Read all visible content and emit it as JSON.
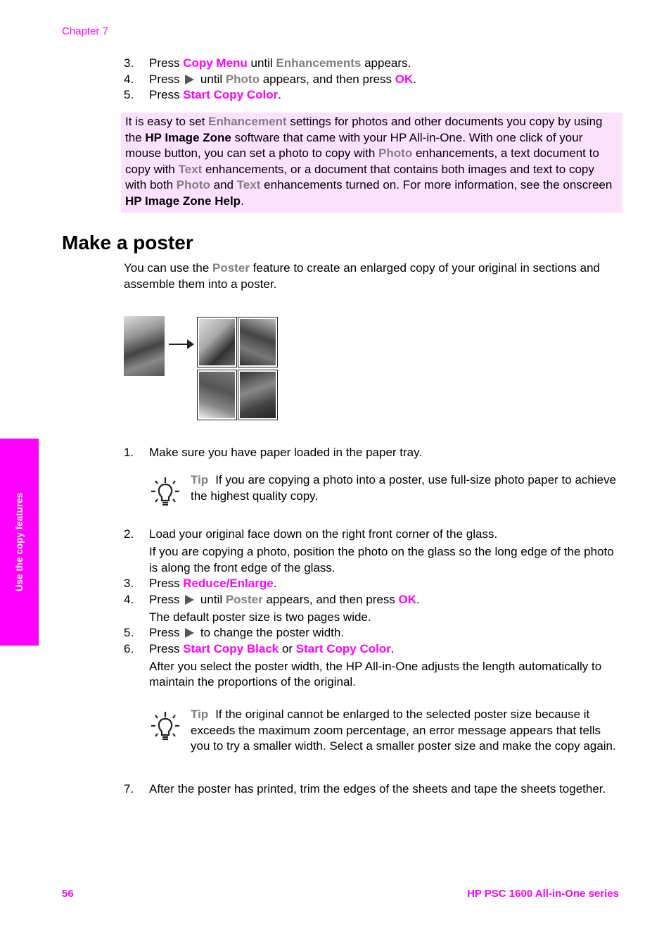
{
  "header": {
    "chapter": "Chapter 7"
  },
  "side_tab": {
    "label": "Use the copy features"
  },
  "top_steps": [
    {
      "num": "3.",
      "parts": [
        {
          "t": "Press ",
          "s": ""
        },
        {
          "t": "Copy Menu",
          "s": "magenta"
        },
        {
          "t": " until ",
          "s": ""
        },
        {
          "t": "Enhancements",
          "s": "gray"
        },
        {
          "t": " appears.",
          "s": ""
        }
      ]
    },
    {
      "num": "4.",
      "parts": [
        {
          "t": "Press ",
          "s": ""
        },
        {
          "t": "",
          "s": "arrow"
        },
        {
          "t": " until ",
          "s": ""
        },
        {
          "t": "Photo",
          "s": "gray"
        },
        {
          "t": " appears, and then press ",
          "s": ""
        },
        {
          "t": "OK",
          "s": "magenta"
        },
        {
          "t": ".",
          "s": ""
        }
      ]
    },
    {
      "num": "5.",
      "parts": [
        {
          "t": "Press ",
          "s": ""
        },
        {
          "t": "Start Copy Color",
          "s": "magenta"
        },
        {
          "t": ".",
          "s": ""
        }
      ]
    }
  ],
  "note": {
    "parts": [
      {
        "t": "It is easy to set ",
        "s": ""
      },
      {
        "t": "Enhancement",
        "s": "gray"
      },
      {
        "t": " settings for photos and other documents you copy by using the ",
        "s": ""
      },
      {
        "t": "HP Image Zone",
        "s": "bold"
      },
      {
        "t": " software that came with your HP All-in-One. With one click of your mouse button, you can set a photo to copy with ",
        "s": ""
      },
      {
        "t": "Photo",
        "s": "gray"
      },
      {
        "t": " enhancements, a text document to copy with ",
        "s": ""
      },
      {
        "t": "Text",
        "s": "gray"
      },
      {
        "t": " enhancements, or a document that contains both images and text to copy with both ",
        "s": ""
      },
      {
        "t": "Photo",
        "s": "gray"
      },
      {
        "t": " and ",
        "s": ""
      },
      {
        "t": "Text",
        "s": "gray"
      },
      {
        "t": " enhancements turned on. For more information, see the onscreen ",
        "s": ""
      },
      {
        "t": "HP Image Zone Help",
        "s": "bold"
      },
      {
        "t": ".",
        "s": ""
      }
    ]
  },
  "section": {
    "title": "Make a poster",
    "intro": [
      {
        "t": "You can use the ",
        "s": ""
      },
      {
        "t": "Poster",
        "s": "gray"
      },
      {
        "t": " feature to create an enlarged copy of your original in sections and assemble them into a poster.",
        "s": ""
      }
    ],
    "figure": {
      "original": "tiger-original-image",
      "tiles": [
        "tiger-tile-top-left",
        "tiger-tile-top-right",
        "tiger-tile-bottom-left",
        "tiger-tile-bottom-right"
      ]
    }
  },
  "step1": {
    "num": "1.",
    "parts": [
      {
        "t": "Make sure you have paper loaded in the paper tray.",
        "s": ""
      }
    ]
  },
  "tip1": {
    "label": "Tip",
    "text": "If you are copying a photo into a poster, use full-size photo paper to achieve the highest quality copy.",
    "icon": "lightbulb-icon"
  },
  "mid_steps": [
    {
      "num": "2.",
      "parts": [
        {
          "t": "Load your original face down on the right front corner of the glass.",
          "s": ""
        }
      ],
      "sub": "If you are copying a photo, position the photo on the glass so the long edge of the photo is along the front edge of the glass."
    },
    {
      "num": "3.",
      "parts": [
        {
          "t": "Press ",
          "s": ""
        },
        {
          "t": "Reduce/Enlarge",
          "s": "magenta"
        },
        {
          "t": ".",
          "s": ""
        }
      ]
    },
    {
      "num": "4.",
      "parts": [
        {
          "t": "Press ",
          "s": ""
        },
        {
          "t": "",
          "s": "arrow"
        },
        {
          "t": " until ",
          "s": ""
        },
        {
          "t": "Poster",
          "s": "gray"
        },
        {
          "t": " appears, and then press ",
          "s": ""
        },
        {
          "t": "OK",
          "s": "magenta"
        },
        {
          "t": ".",
          "s": ""
        }
      ],
      "sub": "The default poster size is two pages wide."
    },
    {
      "num": "5.",
      "parts": [
        {
          "t": "Press ",
          "s": ""
        },
        {
          "t": "",
          "s": "arrow"
        },
        {
          "t": " to change the poster width.",
          "s": ""
        }
      ]
    },
    {
      "num": "6.",
      "parts": [
        {
          "t": "Press ",
          "s": ""
        },
        {
          "t": "Start Copy Black",
          "s": "magenta"
        },
        {
          "t": " or ",
          "s": ""
        },
        {
          "t": "Start Copy Color",
          "s": "magenta"
        },
        {
          "t": ".",
          "s": ""
        }
      ],
      "sub": "After you select the poster width, the HP All-in-One adjusts the length automatically to maintain the proportions of the original."
    }
  ],
  "tip2": {
    "label": "Tip",
    "text": "If the original cannot be enlarged to the selected poster size because it exceeds the maximum zoom percentage, an error message appears that tells you to try a smaller width. Select a smaller poster size and make the copy again.",
    "icon": "lightbulb-icon"
  },
  "step7": {
    "num": "7.",
    "parts": [
      {
        "t": "After the poster has printed, trim the edges of the sheets and tape the sheets together.",
        "s": ""
      }
    ]
  },
  "footer": {
    "page_number": "56",
    "title": "HP PSC 1600 All-in-One series"
  }
}
